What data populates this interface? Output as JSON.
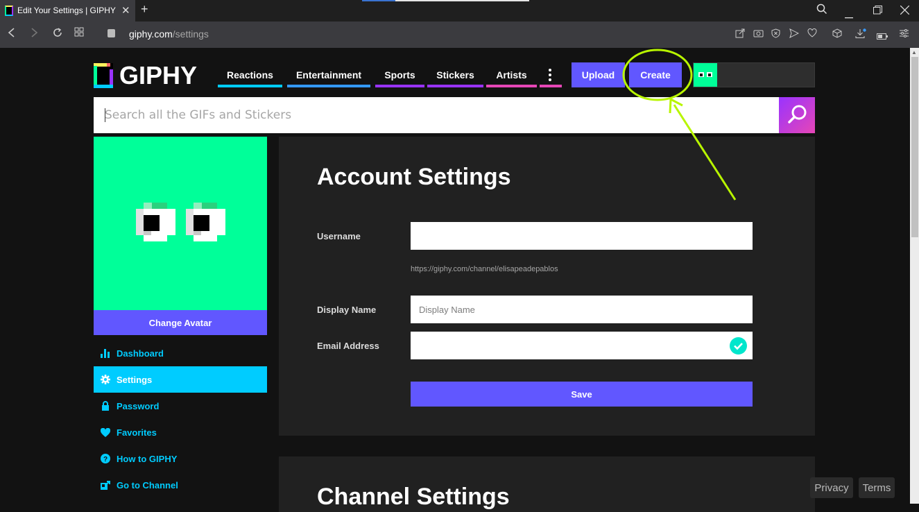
{
  "browser": {
    "tab_title": "Edit Your Settings | GIPHY",
    "tab_close": "✕",
    "new_tab": "+",
    "url_host": "giphy.com",
    "url_path": "/settings"
  },
  "header": {
    "logo_text": "GIPHY",
    "nav": [
      {
        "label": "Reactions",
        "color": "#00ccff"
      },
      {
        "label": "Entertainment",
        "color": "#3399ff"
      },
      {
        "label": "Sports",
        "color": "#9933ff"
      },
      {
        "label": "Stickers",
        "color": "#9933ff"
      },
      {
        "label": "Artists",
        "color": "#e646b6"
      }
    ],
    "upload_label": "Upload",
    "create_label": "Create"
  },
  "search": {
    "placeholder": "Search all the GIFs and Stickers"
  },
  "sidebar": {
    "change_avatar_label": "Change Avatar",
    "items": [
      {
        "label": "Dashboard",
        "icon": "bar-chart-icon"
      },
      {
        "label": "Settings",
        "icon": "gear-icon",
        "active": true
      },
      {
        "label": "Password",
        "icon": "lock-icon"
      },
      {
        "label": "Favorites",
        "icon": "heart-icon"
      },
      {
        "label": "How to GIPHY",
        "icon": "question-icon"
      },
      {
        "label": "Go to Channel",
        "icon": "external-link-icon"
      }
    ]
  },
  "account": {
    "title": "Account Settings",
    "username_label": "Username",
    "username_value": "",
    "channel_url": "https://giphy.com/channel/elisapeadepablos",
    "display_name_label": "Display Name",
    "display_name_placeholder": "Display Name",
    "email_label": "Email Address",
    "email_value": "",
    "save_label": "Save"
  },
  "channel": {
    "title": "Channel Settings"
  },
  "footer": {
    "privacy_label": "Privacy",
    "terms_label": "Terms"
  },
  "colors": {
    "accent": "#6157ff",
    "sidebar_link": "#00ccff",
    "highlight": "#b8f500"
  }
}
